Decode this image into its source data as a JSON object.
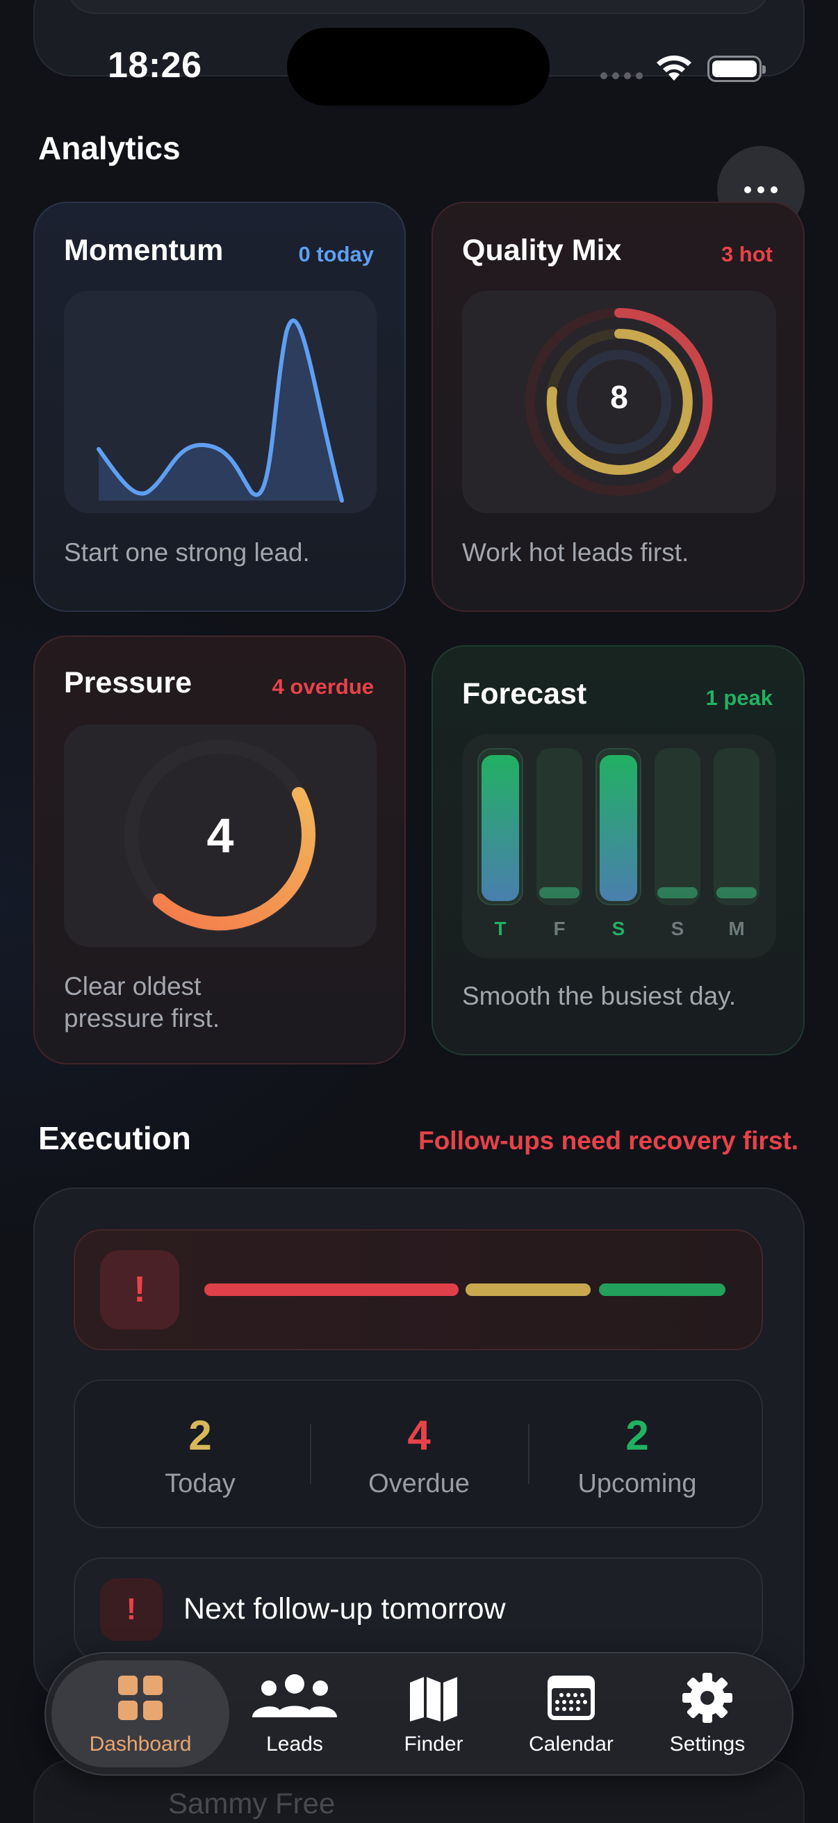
{
  "status_bar": {
    "time": "18:26"
  },
  "analytics": {
    "title": "Analytics",
    "cards": {
      "momentum": {
        "title": "Momentum",
        "badge": "0 today",
        "caption": "Start one strong lead."
      },
      "quality": {
        "title": "Quality Mix",
        "badge": "3 hot",
        "caption": "Work hot leads first.",
        "center_value": "8"
      },
      "pressure": {
        "title": "Pressure",
        "badge": "4 overdue",
        "caption_line1": "Clear oldest",
        "caption_line2": "pressure first.",
        "center_value": "4"
      },
      "forecast": {
        "title": "Forecast",
        "badge": "1 peak",
        "caption": "Smooth the busiest day.",
        "days": [
          "T",
          "F",
          "S",
          "S",
          "M"
        ]
      }
    }
  },
  "execution": {
    "title": "Execution",
    "notice": "Follow-ups need recovery first.",
    "alert_icon": "!",
    "stats": [
      {
        "value": "2",
        "label": "Today",
        "color": "#d9b85c"
      },
      {
        "value": "4",
        "label": "Overdue",
        "color": "#e8424a"
      },
      {
        "value": "2",
        "label": "Upcoming",
        "color": "#22b063"
      }
    ],
    "next": {
      "icon": "!",
      "text": "Next follow-up tomorrow"
    }
  },
  "behind_tabbar_text": "Sammy Free",
  "tabs": [
    {
      "label": "Dashboard",
      "icon": "grid-icon",
      "active": true
    },
    {
      "label": "Leads",
      "icon": "people-icon",
      "active": false
    },
    {
      "label": "Finder",
      "icon": "map-icon",
      "active": false
    },
    {
      "label": "Calendar",
      "icon": "calendar-icon",
      "active": false
    },
    {
      "label": "Settings",
      "icon": "gear-icon",
      "active": false
    }
  ],
  "colors": {
    "momentum_accent": "#5f9ff2",
    "hot_red": "#e8424a",
    "warm_yellow": "#d9b85c",
    "peak_green": "#22b063",
    "pressure_orange": "#f3a24e",
    "active_tab": "#e8a770"
  }
}
